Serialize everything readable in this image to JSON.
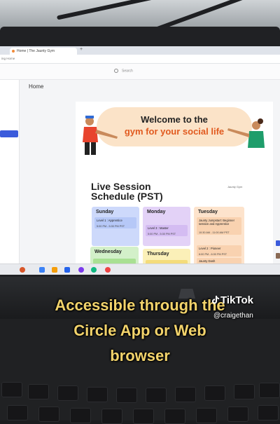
{
  "browser": {
    "tab_title": "Home | The Jaunty Gym",
    "new_tab": "+",
    "address": "ing Home"
  },
  "app": {
    "search_placeholder": "Search",
    "breadcrumb": "Home"
  },
  "banner": {
    "line1": "Welcome to the",
    "line2": "gym for your social life"
  },
  "schedule": {
    "title_line1": "Live Session",
    "title_line2": "Schedule (PST)",
    "brand": "Jaunty Gym",
    "days": [
      {
        "name": "Sunday",
        "color": "#cdd9fb",
        "slots": [
          {
            "text": "Level 1 : Apprentice",
            "time": "5:00 PM - 5:30 PM PST"
          }
        ]
      },
      {
        "name": "Monday",
        "color": "#e3d2f7",
        "slots": [
          {
            "text": "Level 3 : Master",
            "time": "5:00 PM - 5:30 PM PST"
          }
        ]
      },
      {
        "name": "Tuesday",
        "color": "#fde3cc",
        "slots": [
          {
            "text": "Jaunty Jumpstart: Beginner session and Apprentice",
            "time": "10:30 AM - 11:00 AM PST"
          },
          {
            "text": "Level 2 : Pioneer",
            "time": "6:00 PM - 6:30 PM PST"
          },
          {
            "text": "Jaunty Dash",
            "time": "6:30 PM - 7:00 PM PST"
          }
        ]
      },
      {
        "name": "Wednesday",
        "color": "#d3f0c9",
        "slots": []
      },
      {
        "name": "Thursday",
        "color": "#fbf0b8",
        "slots": []
      }
    ]
  },
  "overlay": {
    "caption_line1": "Accessible through the",
    "caption_line2": "Circle App or Web",
    "caption_line3": "browser",
    "tiktok_brand": "TikTok",
    "tiktok_handle": "@craigethan"
  },
  "colors": {
    "accent_orange": "#e15a1f",
    "caption_yellow": "#f2d36b",
    "sidebar_button": "#3b5bdb"
  }
}
